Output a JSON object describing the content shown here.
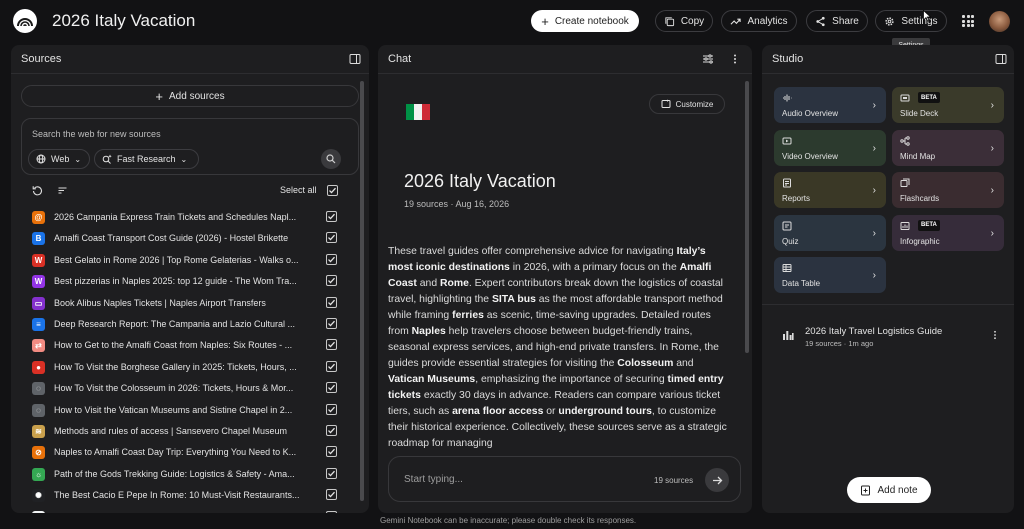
{
  "header": {
    "title": "2026 Italy Vacation",
    "create_label": "Create notebook",
    "copy_label": "Copy",
    "analytics_label": "Analytics",
    "share_label": "Share",
    "settings_label": "Settings",
    "settings_tooltip": "Settings"
  },
  "sources": {
    "title": "Sources",
    "add_label": "Add sources",
    "search_placeholder": "Search the web for new sources",
    "web_chip": "Web",
    "research_chip": "Fast Research",
    "select_all": "Select all",
    "items": [
      {
        "title": "2026 Campania Express Train Tickets and Schedules Napl...",
        "icon_color": "#e8710a",
        "icon": "spiral-icon"
      },
      {
        "title": "Amalfi Coast Transport Cost Guide (2026) - Hostel Brikette",
        "icon_color": "#1a73e8",
        "icon": "b-icon"
      },
      {
        "title": "Best Gelato in Rome 2026 | Top Rome Gelaterias - Walks o...",
        "icon_color": "#d93025",
        "icon": "walks-icon"
      },
      {
        "title": "Best pizzerias in Naples 2025: top 12 guide - The Wom Tra...",
        "icon_color": "#9334e6",
        "icon": "w-icon"
      },
      {
        "title": "Book Alibus Naples Tickets | Naples Airport Transfers",
        "icon_color": "#8430ce",
        "icon": "bus-icon"
      },
      {
        "title": "Deep Research Report: The Campania and Lazio Cultural ...",
        "icon_color": "#1a73e8",
        "icon": "report-icon"
      },
      {
        "title": "How to Get to the Amalfi Coast from Naples: Six Routes - ...",
        "icon_color": "#f28b82",
        "icon": "route-icon"
      },
      {
        "title": "How To Visit the Borghese Gallery in 2025: Tickets, Hours, ...",
        "icon_color": "#d93025",
        "icon": "gallery-icon"
      },
      {
        "title": "How To Visit the Colosseum in 2026: Tickets, Hours & Mor...",
        "icon_color": "#5f6368",
        "icon": "circle-icon"
      },
      {
        "title": "How to Visit the Vatican Museums and Sistine Chapel in 2...",
        "icon_color": "#5f6368",
        "icon": "circle-icon"
      },
      {
        "title": "Methods and rules of access | Sansevero Chapel Museum",
        "icon_color": "#c9a04c",
        "icon": "stack-icon"
      },
      {
        "title": "Naples to Amalfi Coast Day Trip: Everything You Need to K...",
        "icon_color": "#e8710a",
        "icon": "compass-icon"
      },
      {
        "title": "Path of the Gods Trekking Guide: Logistics & Safety - Ama...",
        "icon_color": "#34a853",
        "icon": "sun-icon"
      },
      {
        "title": "The Best Cacio E Pepe In Rome: 10 Must-Visit Restaurants...",
        "icon_color": "#202124",
        "icon": "gear-icon"
      },
      {
        "title": "The Ultimate guide to ...",
        "icon_color": "#f1f3f4",
        "icon": "page-icon"
      }
    ]
  },
  "chat": {
    "title": "Chat",
    "customize_label": "Customize",
    "notebook_title": "2026 Italy Vacation",
    "meta": "19 sources · Aug 16, 2026",
    "summary_segments": [
      {
        "t": "These travel guides offer comprehensive advice for navigating ",
        "b": false
      },
      {
        "t": "Italy’s most iconic destinations",
        "b": true
      },
      {
        "t": " in 2026, with a primary focus on the ",
        "b": false
      },
      {
        "t": "Amalfi Coast",
        "b": true
      },
      {
        "t": " and ",
        "b": false
      },
      {
        "t": "Rome",
        "b": true
      },
      {
        "t": ". Expert contributors break down the logistics of coastal travel, highlighting the ",
        "b": false
      },
      {
        "t": "SITA bus",
        "b": true
      },
      {
        "t": " as the most affordable transport method while framing ",
        "b": false
      },
      {
        "t": "ferries",
        "b": true
      },
      {
        "t": " as scenic, time-saving upgrades. Detailed routes from ",
        "b": false
      },
      {
        "t": "Naples",
        "b": true
      },
      {
        "t": " help travelers choose between budget-friendly trains, seasonal express services, and high-end private transfers. In Rome, the guides provide essential strategies for visiting the ",
        "b": false
      },
      {
        "t": "Colosseum",
        "b": true
      },
      {
        "t": " and ",
        "b": false
      },
      {
        "t": "Vatican Museums",
        "b": true
      },
      {
        "t": ", emphasizing the importance of securing ",
        "b": false
      },
      {
        "t": "timed entry tickets",
        "b": true
      },
      {
        "t": " exactly 30 days in advance. Readers can compare various ticket tiers, such as ",
        "b": false
      },
      {
        "t": "arena floor access",
        "b": true
      },
      {
        "t": " or ",
        "b": false
      },
      {
        "t": "underground tours",
        "b": true
      },
      {
        "t": ", to customize their historical experience. Collectively, these sources serve as a strategic roadmap for managing",
        "b": false
      }
    ],
    "input_placeholder": "Start typing...",
    "source_count": "19 sources",
    "disclaimer": "Gemini Notebook can be inaccurate; please double check its responses."
  },
  "studio": {
    "title": "Studio",
    "beta_label": "BETA",
    "tiles": [
      {
        "label": "Audio Overview",
        "icon": "waveform-icon",
        "color": "#2b3340",
        "beta": false
      },
      {
        "label": "Slide Deck",
        "icon": "slides-icon",
        "color": "#3a3a2a",
        "beta": true
      },
      {
        "label": "Video Overview",
        "icon": "video-icon",
        "color": "#2c3a2e",
        "beta": false
      },
      {
        "label": "Mind Map",
        "icon": "mindmap-icon",
        "color": "#3b2e38",
        "beta": false
      },
      {
        "label": "Reports",
        "icon": "reports-icon",
        "color": "#3a3826",
        "beta": false
      },
      {
        "label": "Flashcards",
        "icon": "flashcards-icon",
        "color": "#3a2c30",
        "beta": false
      },
      {
        "label": "Quiz",
        "icon": "quiz-icon",
        "color": "#2b3540",
        "beta": false
      },
      {
        "label": "Infographic",
        "icon": "infographic-icon",
        "color": "#362c3a",
        "beta": true
      },
      {
        "label": "Data Table",
        "icon": "table-icon",
        "color": "#2b3340",
        "beta": false
      }
    ],
    "note": {
      "title": "2026 Italy Travel Logistics Guide",
      "meta": "19 sources · 1m ago"
    },
    "add_note_label": "Add note"
  }
}
